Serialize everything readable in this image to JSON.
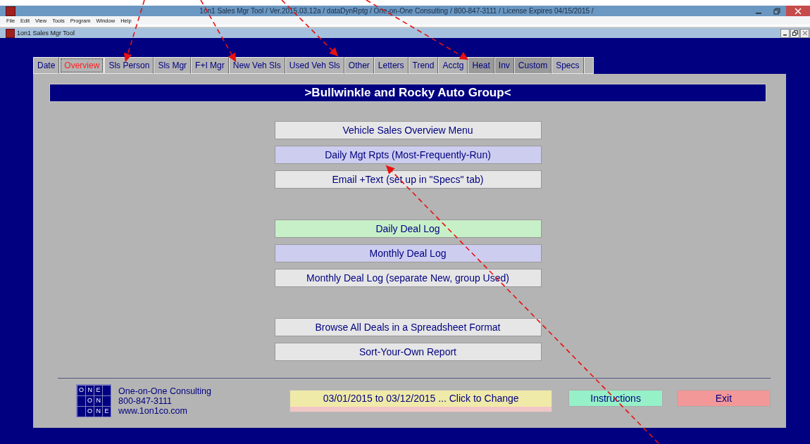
{
  "window": {
    "title": "1on1 Sales Mgr Tool / Ver.2015.03.12a / dataDynRptg / One-on-One Consulting / 800-847-3111 / License Expires 04/15/2015 /"
  },
  "menu": [
    "File",
    "Edit",
    "View",
    "Tools",
    "Program",
    "Window",
    "Help"
  ],
  "child_window": {
    "title": "1on1 Sales Mgr Tool"
  },
  "tabs": [
    {
      "label": "Date",
      "selected": false,
      "dim": false
    },
    {
      "label": "Overview",
      "selected": true,
      "dim": false
    },
    {
      "label": "Sls Person",
      "selected": false,
      "dim": false
    },
    {
      "label": "Sls Mgr",
      "selected": false,
      "dim": false
    },
    {
      "label": "F+I Mgr",
      "selected": false,
      "dim": false
    },
    {
      "label": "New Veh Sls",
      "selected": false,
      "dim": false
    },
    {
      "label": "Used Veh Sls",
      "selected": false,
      "dim": false
    },
    {
      "label": "Other",
      "selected": false,
      "dim": false
    },
    {
      "label": "Letters",
      "selected": false,
      "dim": false
    },
    {
      "label": "Trend",
      "selected": false,
      "dim": false
    },
    {
      "label": "Acctg",
      "selected": false,
      "dim": false
    },
    {
      "label": "Heat",
      "selected": false,
      "dim": true
    },
    {
      "label": "Inv",
      "selected": false,
      "dim": true
    },
    {
      "label": "Custom",
      "selected": false,
      "dim": true
    },
    {
      "label": "Specs",
      "selected": false,
      "dim": false
    }
  ],
  "header": ">Bullwinkle and Rocky Auto Group<",
  "button_groups": [
    [
      {
        "label": "Vehicle Sales Overview Menu",
        "color": "#e6e6e6"
      },
      {
        "label": "Daily Mgt Rpts (Most-Frequently-Run)",
        "color": "#cdcdf0"
      },
      {
        "label": "Email +Text (set up in \"Specs\" tab)",
        "color": "#e6e6e6"
      }
    ],
    [
      {
        "label": "Daily Deal Log",
        "color": "#c8f0c8"
      },
      {
        "label": "Monthly Deal Log",
        "color": "#cdcdf0"
      },
      {
        "label": "Monthly Deal Log (separate New, group Used)",
        "color": "#e6e6e6"
      }
    ],
    [
      {
        "label": "Browse All Deals in a Spreadsheet Format",
        "color": "#e6e6e6"
      },
      {
        "label": "Sort-Your-Own Report",
        "color": "#e6e6e6"
      }
    ]
  ],
  "footer": {
    "logo": [
      "ONE",
      "ON",
      "ONE"
    ],
    "company": "One-on-One Consulting",
    "phone": "800-847-3111",
    "web": "www.1on1co.com",
    "date_button": "03/01/2015 to 03/12/2015 ... Click to Change",
    "instructions": "Instructions",
    "exit": "Exit"
  }
}
